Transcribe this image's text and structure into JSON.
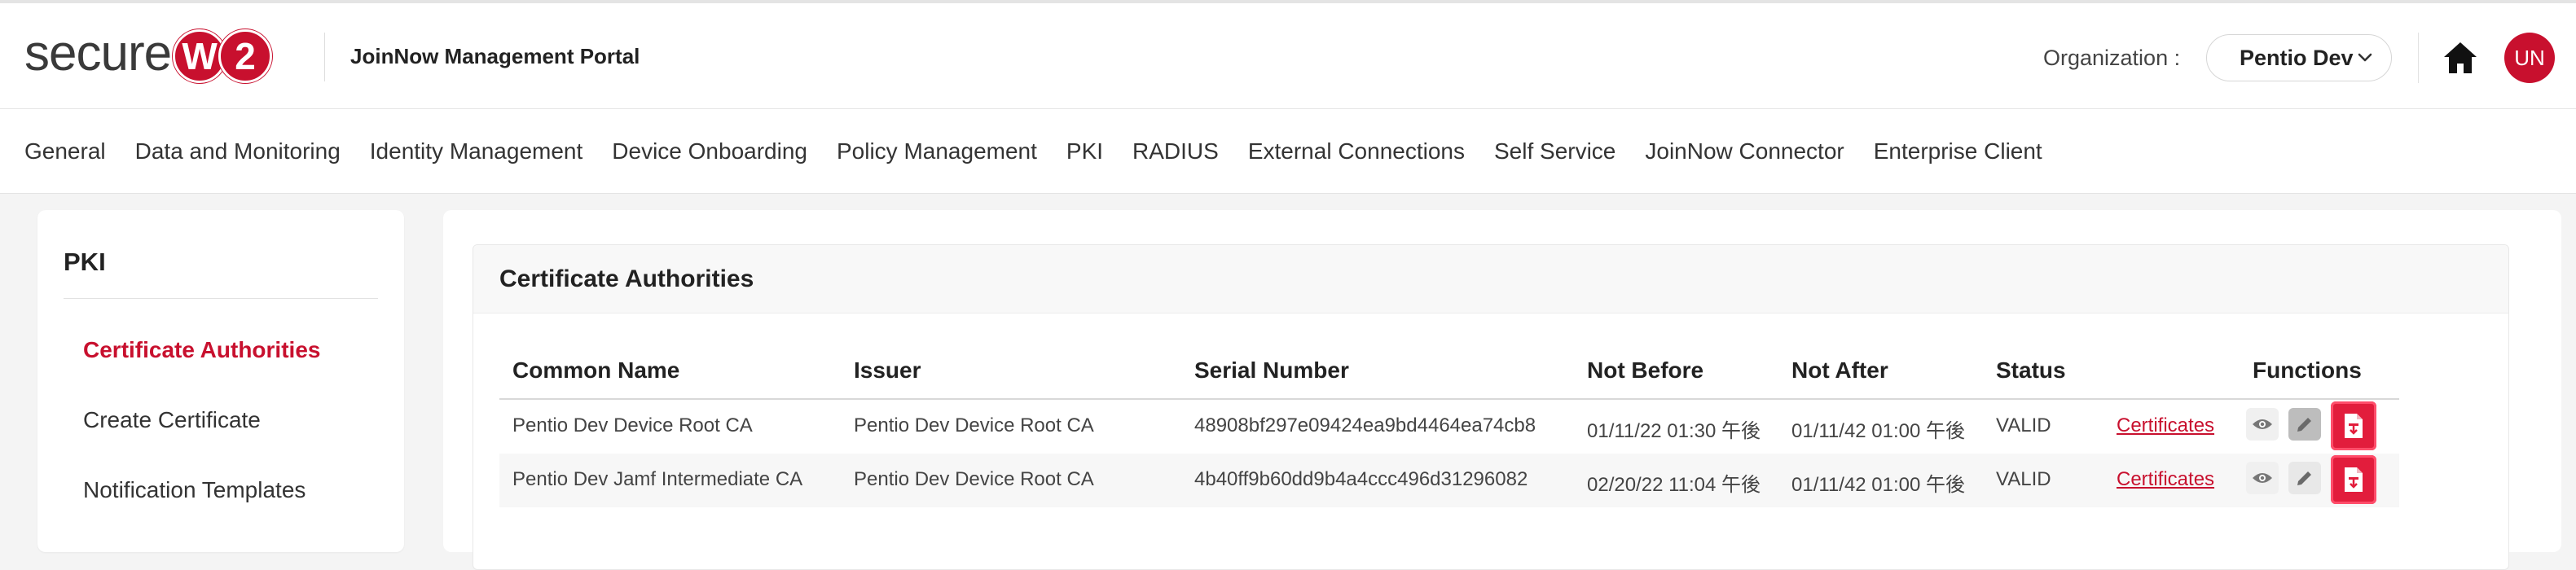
{
  "header": {
    "logo_text": "secure",
    "logo_badge_1": "W",
    "logo_badge_2": "2",
    "portal_title": "JoinNow Management Portal",
    "org_label": "Organization :",
    "org_value": "Pentio Dev",
    "avatar_initials": "UN",
    "brand_color": "#c8102e"
  },
  "nav": {
    "items": [
      {
        "label": "General"
      },
      {
        "label": "Data and Monitoring"
      },
      {
        "label": "Identity Management"
      },
      {
        "label": "Device Onboarding"
      },
      {
        "label": "Policy Management"
      },
      {
        "label": "PKI"
      },
      {
        "label": "RADIUS"
      },
      {
        "label": "External Connections"
      },
      {
        "label": "Self Service"
      },
      {
        "label": "JoinNow Connector"
      },
      {
        "label": "Enterprise Client"
      }
    ]
  },
  "sidebar": {
    "title": "PKI",
    "items": [
      {
        "label": "Certificate Authorities",
        "active": true
      },
      {
        "label": "Create Certificate",
        "active": false
      },
      {
        "label": "Notification Templates",
        "active": false
      }
    ]
  },
  "main": {
    "card_title": "Certificate Authorities",
    "columns": [
      "Common Name",
      "Issuer",
      "Serial Number",
      "Not Before",
      "Not After",
      "Status",
      "Functions"
    ],
    "rows": [
      {
        "common_name": "Pentio Dev Device Root CA",
        "issuer": "Pentio Dev Device Root CA",
        "serial": "48908bf297e09424ea9bd4464ea74cb8",
        "not_before": "01/11/22 01:30 午後",
        "not_after": "01/11/42 01:00 午後",
        "status": "VALID",
        "link": "Certificates"
      },
      {
        "common_name": "Pentio Dev Jamf Intermediate CA",
        "issuer": "Pentio Dev Device Root CA",
        "serial": "4b40ff9b60dd9b4a4ccc496d31296082",
        "not_before": "02/20/22 11:04 午後",
        "not_after": "01/11/42 01:00 午後",
        "status": "VALID",
        "link": "Certificates"
      }
    ],
    "function_icons": [
      "eye-icon",
      "pencil-icon",
      "certificate-download-icon"
    ]
  }
}
